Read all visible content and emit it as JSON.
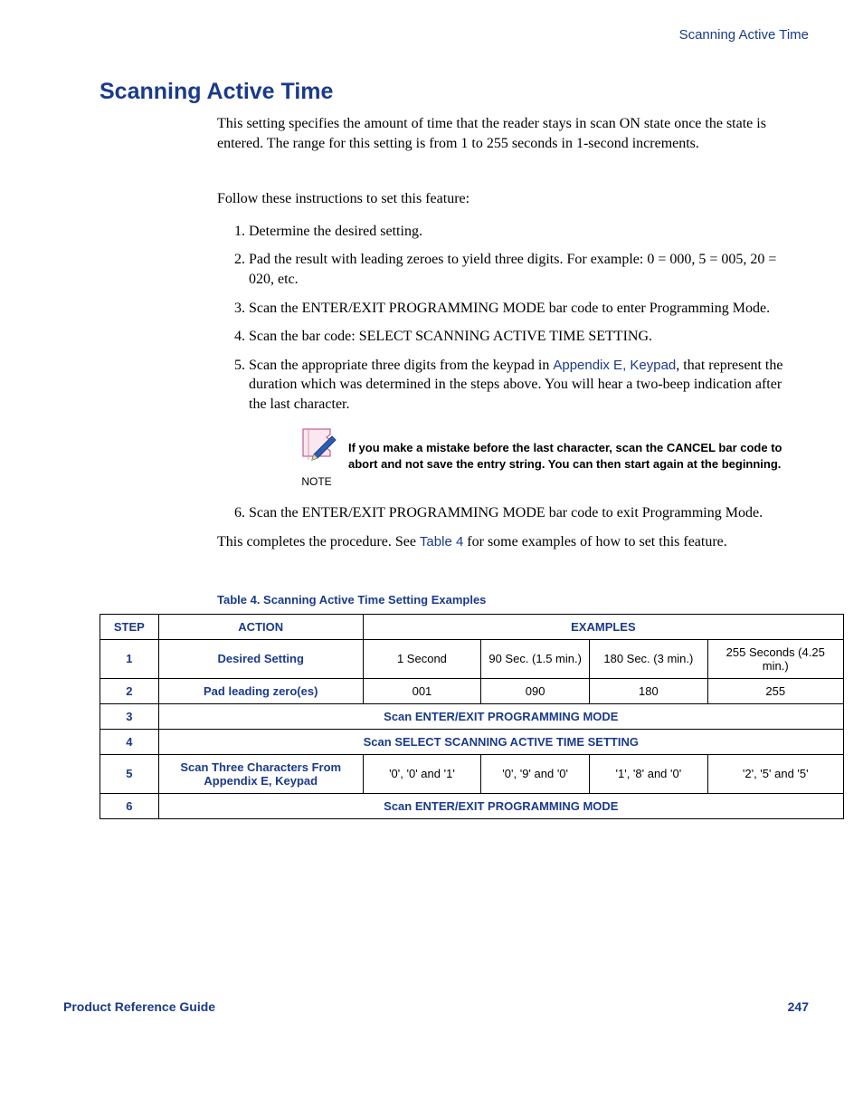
{
  "header": {
    "right": "Scanning Active Time"
  },
  "title": "Scanning Active Time",
  "intro": "This setting specifies the amount of time that the reader stays in scan ON state once the state is entered. The range for this setting is from 1 to 255 seconds in 1-second increments.",
  "follow": "Follow these instructions to set this feature:",
  "steps": {
    "s1": "Determine the desired setting.",
    "s2": "Pad the result with leading zeroes to yield three digits. For example: 0 = 000, 5 = 005, 20 = 020, etc.",
    "s3": "Scan the ENTER/EXIT PROGRAMMING MODE bar code to enter Programming Mode.",
    "s4": "Scan the bar code: SELECT SCANNING ACTIVE TIME SETTING.",
    "s5_a": "Scan the appropriate three digits from the keypad in ",
    "s5_link": "Appendix E, Keypad",
    "s5_b": ", that represent the duration which was determined in the steps above. You will hear a two-beep indication after the last character.",
    "s6": "Scan the ENTER/EXIT PROGRAMMING MODE bar code to exit Programming Mode."
  },
  "note": {
    "label": "NOTE",
    "text": "If you make a mistake before the last character, scan the CANCEL bar code to abort and not save the entry string. You can then start again at the beginning."
  },
  "outro_a": "This completes the procedure. See ",
  "outro_link": "Table 4",
  "outro_b": " for some examples of how to set this feature.",
  "table": {
    "caption": "Table 4. Scanning Active Time Setting Examples",
    "head": {
      "step": "STEP",
      "action": "ACTION",
      "examples": "EXAMPLES"
    },
    "rows": {
      "r1": {
        "step": "1",
        "action": "Desired Setting",
        "c1": "1 Second",
        "c2": "90 Sec. (1.5 min.)",
        "c3": "180 Sec. (3 min.)",
        "c4": "255 Seconds (4.25 min.)"
      },
      "r2": {
        "step": "2",
        "action": "Pad leading zero(es)",
        "c1": "001",
        "c2": "090",
        "c3": "180",
        "c4": "255"
      },
      "r3": {
        "step": "3",
        "span": "Scan ENTER/EXIT PROGRAMMING MODE"
      },
      "r4": {
        "step": "4",
        "span": "Scan SELECT SCANNING ACTIVE TIME SETTING"
      },
      "r5": {
        "step": "5",
        "action_a": "Scan Three Characters From ",
        "action_link": "Appendix E, Keypad",
        "c1": "'0', '0' and '1'",
        "c2": "'0', '9' and '0'",
        "c3": "'1', '8' and '0'",
        "c4": "'2', '5' and '5'"
      },
      "r6": {
        "step": "6",
        "span": "Scan ENTER/EXIT PROGRAMMING MODE"
      }
    }
  },
  "footer": {
    "left": "Product Reference Guide",
    "right": "247"
  }
}
